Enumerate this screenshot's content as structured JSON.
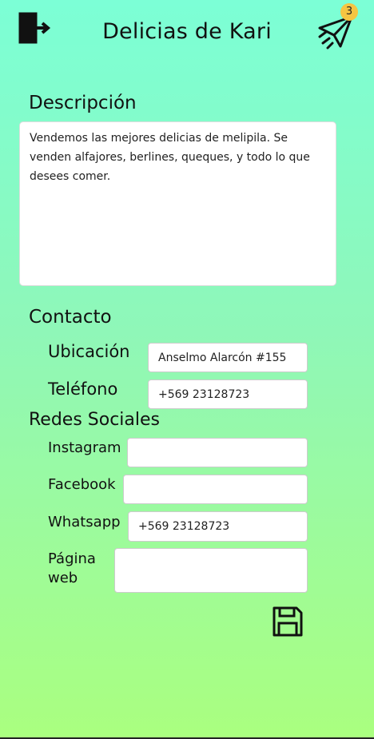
{
  "header": {
    "title": "Delicias de Kari",
    "logout_icon": "logout-door-icon",
    "send_icon": "paper-plane-icon",
    "badge_count": "3",
    "badge_color": "#f5c542"
  },
  "description": {
    "title": "Descripción",
    "text": "Vendemos las mejores delicias de melipila. Se venden alfajores, berlines, queques, y todo lo que desees comer."
  },
  "contact": {
    "title": "Contacto",
    "location_label": "Ubicación",
    "location_value": "Anselmo Alarcón #155",
    "phone_label": "Teléfono",
    "phone_value": "+569 23128723"
  },
  "social": {
    "title": "Redes Sociales",
    "instagram_label": "Instagram",
    "instagram_value": "",
    "facebook_label": "Facebook",
    "facebook_value": "",
    "whatsapp_label": "Whatsapp",
    "whatsapp_value": "+569 23128723",
    "web_label": "Página web",
    "web_value": ""
  },
  "actions": {
    "save_icon": "floppy-disk-icon"
  },
  "colors": {
    "background_top": "#7cffd6",
    "background_bottom": "#aaff7f"
  }
}
